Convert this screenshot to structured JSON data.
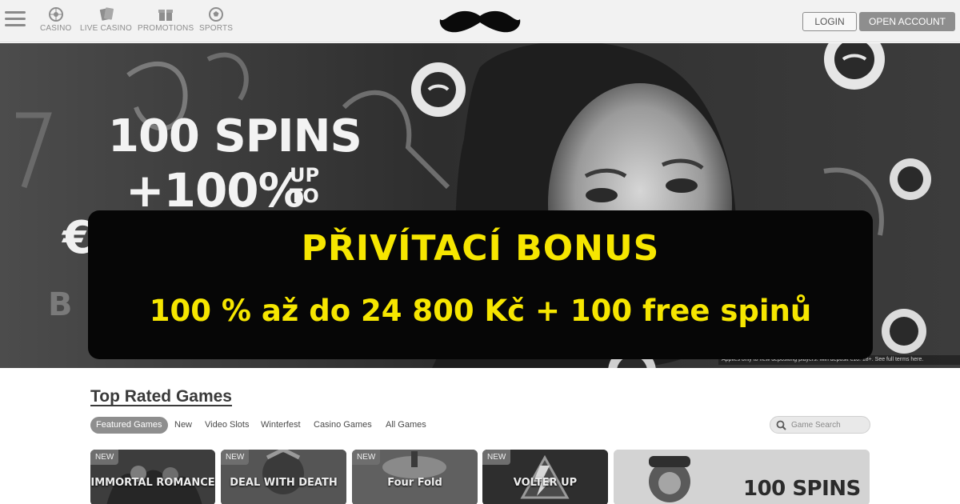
{
  "header": {
    "nav": [
      {
        "label": "CASINO",
        "icon": "roulette-icon"
      },
      {
        "label": "LIVE CASINO",
        "icon": "cards-icon"
      },
      {
        "label": "PROMOTIONS",
        "icon": "gift-icon"
      },
      {
        "label": "SPORTS",
        "icon": "football-icon"
      }
    ],
    "logo_icon": "mustache-icon",
    "login_label": "LOGIN",
    "open_account_label": "OPEN ACCOUNT"
  },
  "hero": {
    "line1": "100 SPINS",
    "line2": "+100%",
    "upto_line1": "UP",
    "upto_line2": "TO",
    "terms": "Applies only to new depositing players. Min deposit €10. 18+. See full terms here."
  },
  "overlay": {
    "title": "PŘIVÍTACÍ BONUS",
    "subtitle": "100 % až do 24 800 Kč + 100 free spinů",
    "text_color": "#f6e600",
    "background": "#060606"
  },
  "games": {
    "title": "Top Rated Games",
    "tabs": [
      "Featured Games",
      "New",
      "Video Slots",
      "Winterfest",
      "Casino Games",
      "All Games"
    ],
    "search_placeholder": "Game Search",
    "tiles": [
      {
        "badge": "NEW",
        "name": "IMMORTAL ROMANCE"
      },
      {
        "badge": "NEW",
        "name": "DEAL WITH DEATH"
      },
      {
        "badge": "NEW",
        "name": "Four Fold"
      },
      {
        "badge": "NEW",
        "name": "VOLTER UP"
      }
    ],
    "promo_tile": {
      "text": "100 SPINS"
    }
  }
}
